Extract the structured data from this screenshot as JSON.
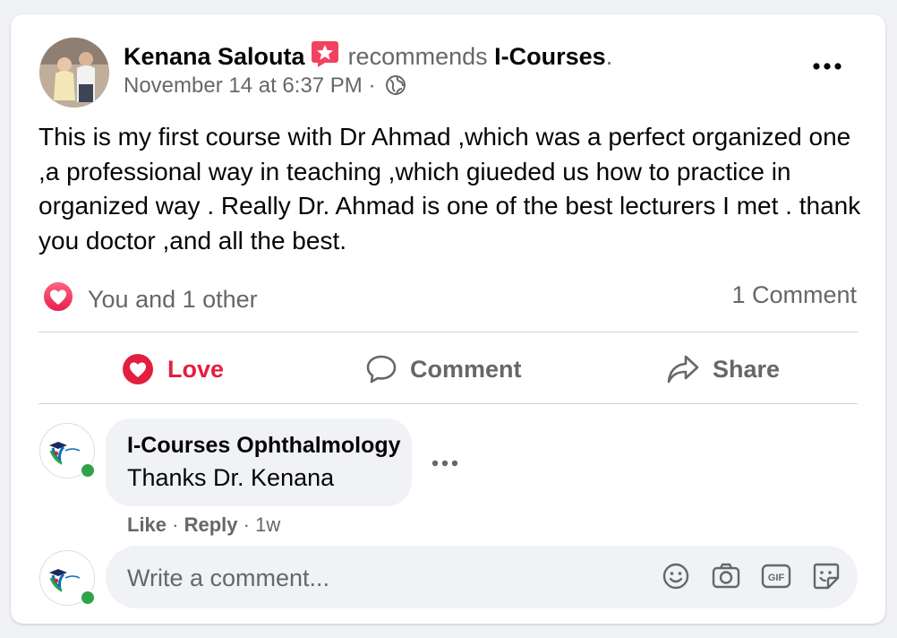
{
  "post": {
    "author": "Kenana Salouta",
    "recommends_text": "recommends",
    "page_name": "I-Courses",
    "page_suffix": ".",
    "timestamp": "November 14 at 6:37 PM",
    "separator": " · ",
    "privacy_icon": "globe-icon",
    "body": "This is my first course with Dr Ahmad ,which was a perfect organized one ,a professional way in teaching ,which giueded us how to practice in organized way . Really Dr. Ahmad is one of the best lecturers I met . thank you doctor ,and all the best."
  },
  "reactions": {
    "summary": "You and 1 other",
    "comment_count": "1 Comment"
  },
  "actions": {
    "love": "Love",
    "comment": "Comment",
    "share": "Share"
  },
  "comment": {
    "author": "I-Courses Ophthalmology",
    "text": "Thanks Dr. Kenana",
    "like": "Like",
    "separator": " · ",
    "reply": "Reply",
    "age": "1w"
  },
  "composer": {
    "placeholder": "Write a comment...",
    "tools": [
      "emoji-icon",
      "camera-icon",
      "gif-icon",
      "sticker-icon"
    ]
  },
  "colors": {
    "love": "#e41e3f",
    "muted": "#65676b",
    "online": "#31a24c",
    "badge": "#f3425f"
  }
}
